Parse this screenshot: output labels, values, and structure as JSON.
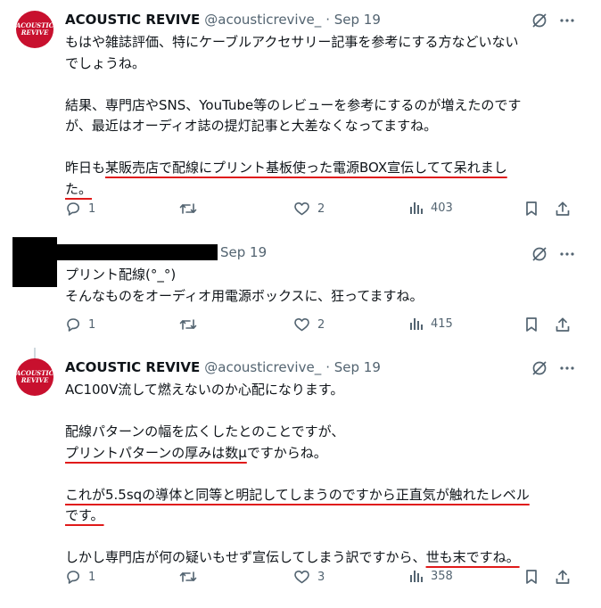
{
  "tweets": [
    {
      "author": "ACOUSTIC REVIVE",
      "handle": "@acousticrevive_",
      "date": "· Sep 19",
      "avatar_text": [
        "ACOUSTIC",
        "REVIVE"
      ],
      "lines": [
        {
          "text": "もはや雑誌評価、特にケーブルアクセサリー記事を参考にする方などいない"
        },
        {
          "text": "でしょうね。"
        },
        {
          "text": ""
        },
        {
          "text": "結果、専門店やSNS、YouTube等のレビューを参考にするのが増えたのです"
        },
        {
          "text": "が、最近はオーディオ誌の提灯記事と大差なくなってますね。"
        },
        {
          "text": ""
        },
        {
          "pre": "昨日も",
          "ul": "某販売店で配線にプリント基板使った電源BOX宣伝してて呆れまし"
        },
        {
          "ul": "た。"
        }
      ],
      "stats": {
        "replies": "1",
        "retweets": "",
        "likes": "2",
        "views": "403"
      }
    },
    {
      "author": "",
      "handle": "",
      "date": "Sep 19",
      "lines": [
        {
          "text": "プリント配線(°_°)"
        },
        {
          "text": "そんなものをオーディオ用電源ボックスに、狂ってますね。"
        }
      ],
      "stats": {
        "replies": "1",
        "retweets": "",
        "likes": "2",
        "views": "415"
      }
    },
    {
      "author": "ACOUSTIC REVIVE",
      "handle": "@acousticrevive_",
      "date": "· Sep 19",
      "avatar_text": [
        "ACOUSTIC",
        "REVIVE"
      ],
      "lines": [
        {
          "text": "AC100V流して燃えないのか心配になります。"
        },
        {
          "text": ""
        },
        {
          "text": "配線パターンの幅を広くしたとのことですが、"
        },
        {
          "ul": "プリントパターンの厚みは数µ",
          "post": "ですからね。"
        },
        {
          "text": ""
        },
        {
          "ul": "これが5.5sqの導体と同等と明記してしまうのですから正直気が触れたレベル"
        },
        {
          "ul": "です。"
        },
        {
          "text": ""
        },
        {
          "pre": "しかし専門店が何の疑いもせず宣伝してしまう訳ですから、",
          "ul": "世も末ですね。"
        }
      ],
      "stats": {
        "replies": "1",
        "retweets": "",
        "likes": "3",
        "views": "358"
      }
    }
  ],
  "icons": {
    "more": "more-options-icon",
    "grok": "grok-icon",
    "reply": "reply-icon",
    "retweet": "retweet-icon",
    "like": "like-icon",
    "views": "views-icon",
    "bookmark": "bookmark-icon",
    "share": "share-icon"
  },
  "colors": {
    "underline": "#e01a1a",
    "avatar_bg": "#c8102e",
    "secondary_text": "#536471"
  }
}
